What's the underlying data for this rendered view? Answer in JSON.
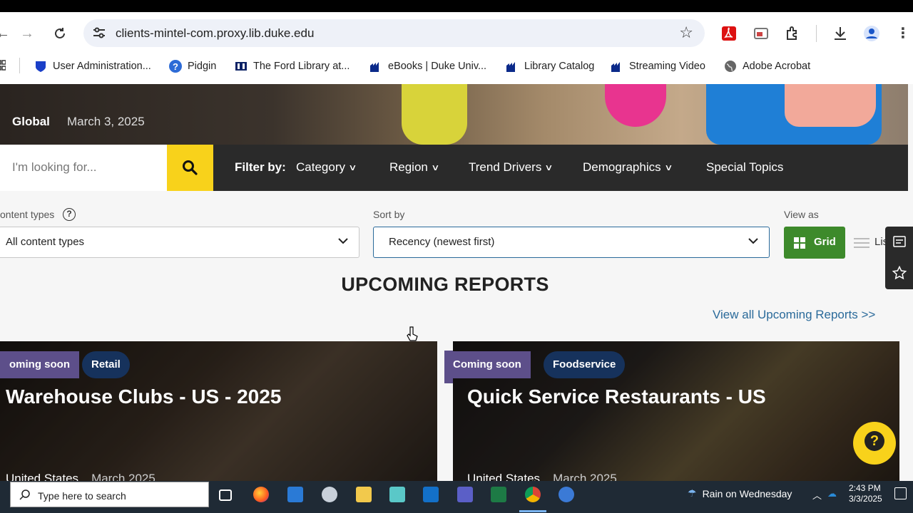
{
  "browser": {
    "url": "clients-mintel-com.proxy.lib.duke.edu",
    "bookmarks": [
      {
        "label": "User Administration...",
        "icon": "shield-icon"
      },
      {
        "label": "Pidgin",
        "icon": "question-icon"
      },
      {
        "label": "The Ford Library at...",
        "icon": "library-icon"
      },
      {
        "label": "eBooks | Duke Univ...",
        "icon": "duke-icon"
      },
      {
        "label": "Library Catalog",
        "icon": "duke-icon"
      },
      {
        "label": "Streaming Video",
        "icon": "duke-icon"
      },
      {
        "label": "Adobe Acrobat",
        "icon": "globe-icon"
      }
    ]
  },
  "hero": {
    "region": "Global",
    "date": "March 3, 2025"
  },
  "filterbar": {
    "search_placeholder": "I'm looking for...",
    "filter_label": "Filter by:",
    "filters": [
      "Category",
      "Region",
      "Trend Drivers",
      "Demographics",
      "Special Topics"
    ]
  },
  "controls": {
    "content_types_label": "ontent types",
    "content_types_value": "All content types",
    "sort_label": "Sort by",
    "sort_value": "Recency (newest first)",
    "view_label": "View as",
    "grid_label": "Grid",
    "list_label": "Lis"
  },
  "section": {
    "title": "UPCOMING REPORTS",
    "view_all": "View all Upcoming Reports >>"
  },
  "cards": [
    {
      "soon": "oming soon",
      "category": "Retail",
      "title": "Warehouse Clubs - US - 2025",
      "region": "United States",
      "date": "March 2025"
    },
    {
      "soon": "Coming soon",
      "category": "Foodservice",
      "title": "Quick Service Restaurants - US",
      "region": "United States",
      "date": "March 2025"
    }
  ],
  "taskbar": {
    "search_placeholder": "Type here to search",
    "weather": "Rain on Wednesday",
    "time": "2:43 PM",
    "date": "3/3/2025"
  }
}
